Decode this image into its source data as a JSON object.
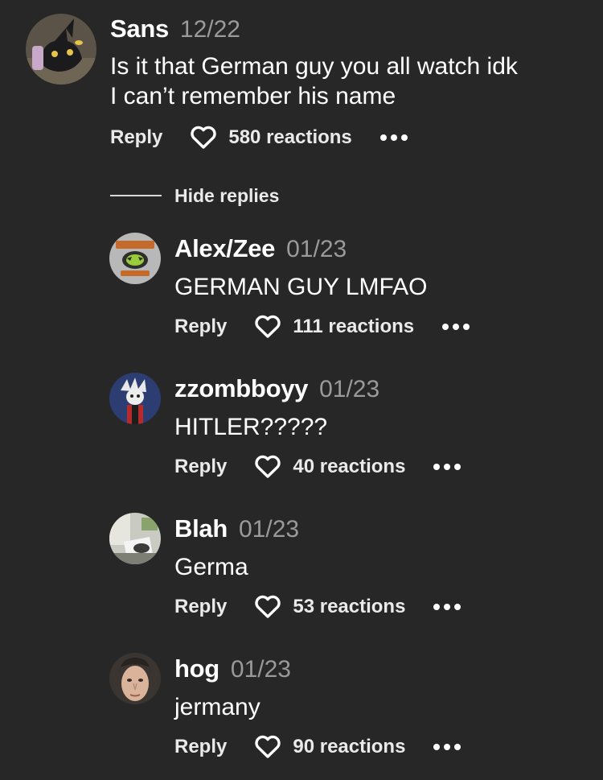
{
  "top_comment": {
    "author": "Sans",
    "date": "12/22",
    "text": "Is it that German guy you all watch idk\nI can’t remember his name",
    "reply_label": "Reply",
    "reactions": "580 reactions",
    "avatar_icon": "umbreon-avatar"
  },
  "hide_replies_label": "Hide replies",
  "replies": [
    {
      "author": "Alex/Zee",
      "date": "01/23",
      "text": "GERMAN GUY LMFAO",
      "reply_label": "Reply",
      "reactions": "111 reactions",
      "avatar_icon": "lemon-demon-avatar"
    },
    {
      "author": "zzombboyy",
      "date": "01/23",
      "text": "HITLER?????",
      "reply_label": "Reply",
      "reactions": "40 reactions",
      "avatar_icon": "cartoon-character-avatar"
    },
    {
      "author": "Blah",
      "date": "01/23",
      "text": "Germa",
      "reply_label": "Reply",
      "reactions": "53 reactions",
      "avatar_icon": "photo-avatar"
    },
    {
      "author": "hog",
      "date": "01/23",
      "text": "jermany",
      "reply_label": "Reply",
      "reactions": "90 reactions",
      "avatar_icon": "face-avatar"
    }
  ],
  "colors": {
    "background": "#272727",
    "text": "#ffffff",
    "date": "#9a9a9a"
  }
}
